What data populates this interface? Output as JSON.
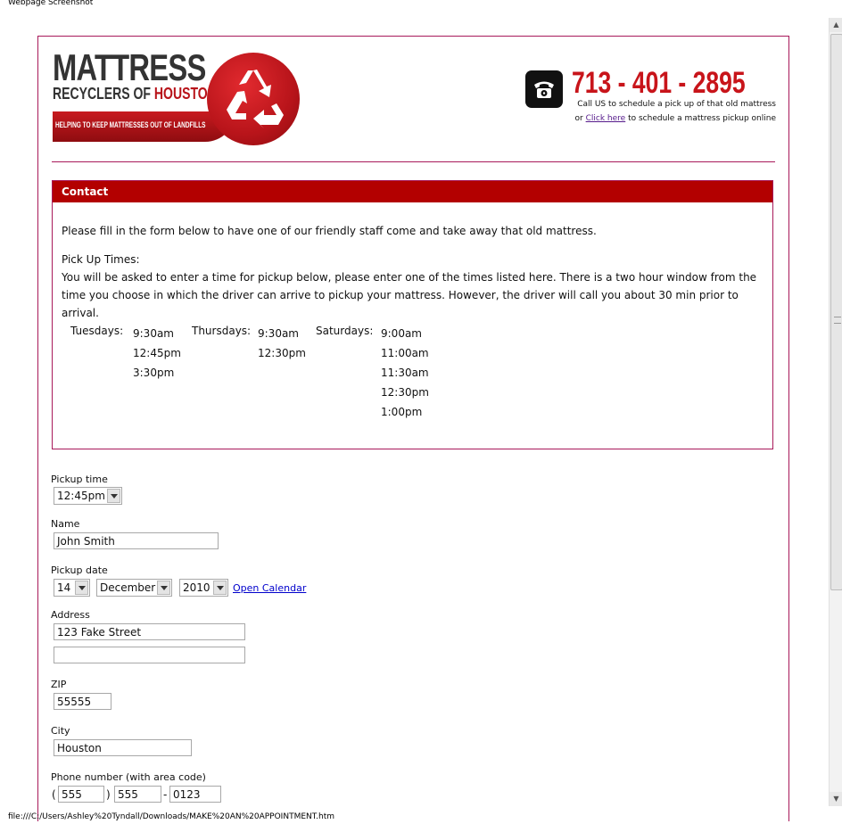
{
  "window": {
    "title": "Webpage Screenshot",
    "status_url": "file:///C:/Users/Ashley%20Tyndall/Downloads/MAKE%20AN%20APPOINTMENT.htm"
  },
  "logo": {
    "line1": "MATTRESS",
    "line2a": "RECYCLERS OF ",
    "line2b": "HOUSTON",
    "tagline": "HELPING TO KEEP MATTRESSES OUT OF LANDFILLS"
  },
  "header": {
    "phone": "713 - 401 - 2895",
    "call_text": "Call US to schedule a pick up of that old mattress",
    "or_text": "or ",
    "click_here": "Click here",
    "online_text": " to schedule a mattress pickup online"
  },
  "contact": {
    "heading": "Contact",
    "intro": "Please fill in the form below to have one of our friendly staff come and take away that old mattress.",
    "pickup_title": "Pick Up Times:",
    "pickup_desc": "You will be asked to enter a time for pickup below, please enter one of the times listed here. There is a two hour window from the time you choose in which the driver can arrive to pickup your mattress. However, the driver will call you about 30 min prior to arrival.",
    "schedule": [
      {
        "day": "Tuesdays:",
        "times": [
          "9:30am",
          "12:45pm",
          "3:30pm"
        ]
      },
      {
        "day": "Thursdays:",
        "times": [
          "9:30am",
          "12:30pm"
        ]
      },
      {
        "day": "Saturdays:",
        "times": [
          "9:00am",
          "11:00am",
          "11:30am",
          "12:30pm",
          "1:00pm"
        ]
      }
    ]
  },
  "form": {
    "pickup_time_label": "Pickup time",
    "pickup_time_value": "12:45pm",
    "name_label": "Name",
    "name_value": "John Smith",
    "pickup_date_label": "Pickup date",
    "day_value": "14",
    "month_value": "December",
    "year_value": "2010",
    "open_calendar": "Open Calendar",
    "address_label": "Address",
    "address1_value": "123 Fake Street",
    "address2_value": "",
    "zip_label": "ZIP",
    "zip_value": "55555",
    "city_label": "City",
    "city_value": "Houston",
    "phone_label": "Phone number (with area code)",
    "phone_open_paren": "(",
    "phone_close_paren": ")",
    "phone_dash": "-",
    "phone_area": "555",
    "phone_prefix": "555",
    "phone_line": "0123"
  },
  "colors": {
    "accent": "#b30000",
    "border": "#a8195a",
    "link": "#0000cc"
  }
}
